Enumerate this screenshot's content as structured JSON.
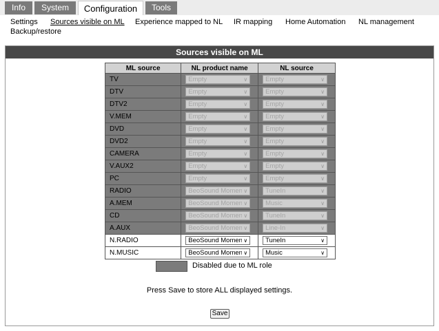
{
  "top_tabs": [
    {
      "label": "Info"
    },
    {
      "label": "System"
    },
    {
      "label": "Configuration"
    },
    {
      "label": "Tools"
    }
  ],
  "sub_nav": [
    {
      "label": "Settings"
    },
    {
      "label": "Sources visible on ML"
    },
    {
      "label": "Experience mapped to NL"
    },
    {
      "label": "IR mapping"
    },
    {
      "label": "Home Automation"
    },
    {
      "label": "NL management"
    },
    {
      "label": "Backup/restore"
    }
  ],
  "active_top_tab": "Configuration",
  "active_sub_nav": "Sources visible on ML",
  "panel": {
    "title": "Sources visible on ML",
    "headers": [
      "ML source",
      "NL product name",
      "NL source"
    ],
    "rows": [
      {
        "ml_source": "TV",
        "product": "Empty",
        "nl_source": "Empty",
        "disabled": true
      },
      {
        "ml_source": "DTV",
        "product": "Empty",
        "nl_source": "Empty",
        "disabled": true
      },
      {
        "ml_source": "DTV2",
        "product": "Empty",
        "nl_source": "Empty",
        "disabled": true
      },
      {
        "ml_source": "V.MEM",
        "product": "Empty",
        "nl_source": "Empty",
        "disabled": true
      },
      {
        "ml_source": "DVD",
        "product": "Empty",
        "nl_source": "Empty",
        "disabled": true
      },
      {
        "ml_source": "DVD2",
        "product": "Empty",
        "nl_source": "Empty",
        "disabled": true
      },
      {
        "ml_source": "CAMERA",
        "product": "Empty",
        "nl_source": "Empty",
        "disabled": true
      },
      {
        "ml_source": "V.AUX2",
        "product": "Empty",
        "nl_source": "Empty",
        "disabled": true
      },
      {
        "ml_source": "PC",
        "product": "Empty",
        "nl_source": "Empty",
        "disabled": true
      },
      {
        "ml_source": "RADIO",
        "product": "BeoSound Moment",
        "nl_source": "TuneIn",
        "disabled": true
      },
      {
        "ml_source": "A.MEM",
        "product": "BeoSound Moment",
        "nl_source": "Music",
        "disabled": true
      },
      {
        "ml_source": "CD",
        "product": "BeoSound Moment",
        "nl_source": "TuneIn",
        "disabled": true
      },
      {
        "ml_source": "A.AUX",
        "product": "BeoSound Moment",
        "nl_source": "Line-In",
        "disabled": true
      },
      {
        "ml_source": "N.RADIO",
        "product": "BeoSound Moment",
        "nl_source": "TuneIn",
        "disabled": false
      },
      {
        "ml_source": "N.MUSIC",
        "product": "BeoSound Moment",
        "nl_source": "Music",
        "disabled": false
      }
    ],
    "legend_text": "Disabled due to ML role",
    "save_hint": "Press Save to store ALL displayed settings.",
    "save_label": "Save"
  },
  "colors": {
    "tab_bg": "#7a7a7a",
    "title_bar": "#474747",
    "disabled_row": "#7b7b7b",
    "header_bg": "#d2d2d2"
  },
  "icons": {
    "select_arrow": "chevron-down-icon"
  }
}
